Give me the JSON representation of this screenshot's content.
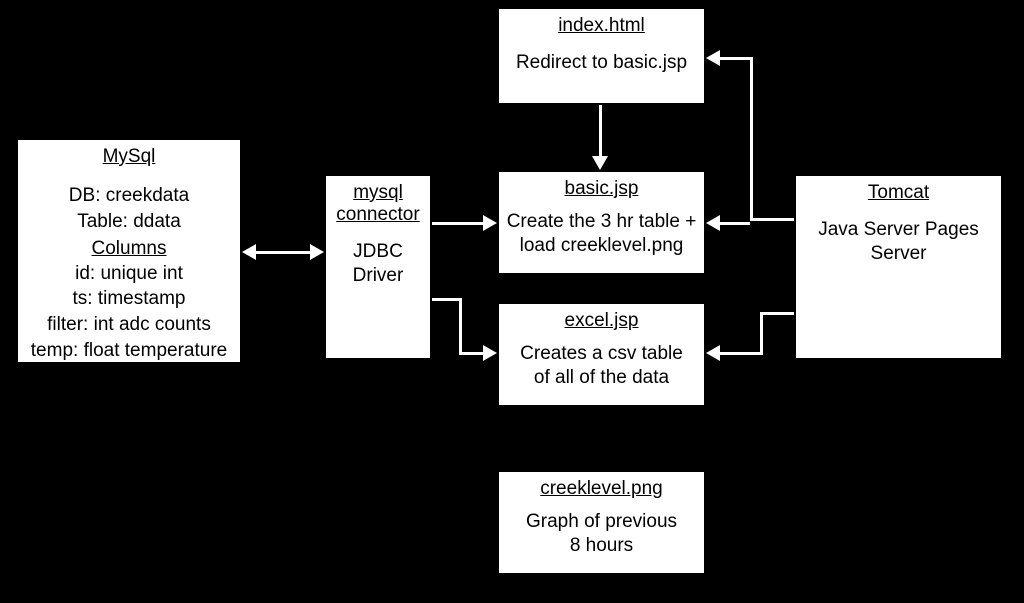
{
  "mysql": {
    "title": "MySql",
    "db": "DB: creekdata",
    "table": "Table: ddata",
    "columns_label": "Columns",
    "columns": {
      "id": "id: unique int",
      "ts": "ts: timestamp",
      "filter": "filter: int adc counts",
      "temp": "temp: float temperature"
    }
  },
  "connector": {
    "title1": "mysql",
    "title2": "connector",
    "body": "JDBC\nDriver"
  },
  "index": {
    "title": "index.html",
    "body": "Redirect to basic.jsp"
  },
  "basic": {
    "title": "basic.jsp",
    "body": "Create the 3 hr table +\nload creeklevel.png"
  },
  "excel": {
    "title": "excel.jsp",
    "body": "Creates a csv table\nof all of the data"
  },
  "creeklevel": {
    "title": "creeklevel.png",
    "body": "Graph of previous\n8 hours"
  },
  "tomcat": {
    "title": "Tomcat",
    "body": "Java Server Pages\nServer"
  }
}
